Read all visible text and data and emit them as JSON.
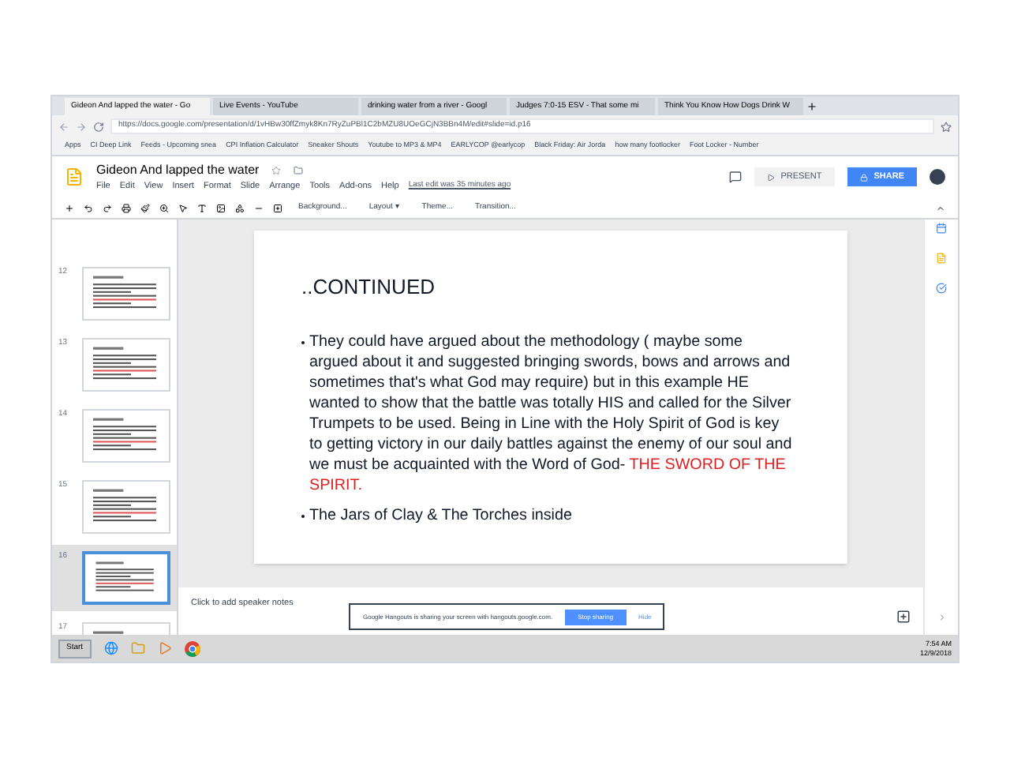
{
  "browser": {
    "tabs": [
      {
        "title": "Gideon And lapped the water - Go",
        "selected": true
      },
      {
        "title": "Live Events - YouTube",
        "selected": false
      },
      {
        "title": "drinking water from a river - Googl",
        "selected": false
      },
      {
        "title": "Judges 7:0-15 ESV - That some mi",
        "selected": false
      },
      {
        "title": "Think You Know How Dogs Drink W",
        "selected": false
      }
    ],
    "url": "https://docs.google.com/presentation/d/1vHBw30ffZmyk8Kn7RyZuPBl1C2bMZU8UOeGCjN3BBn4M/edit#slide=id.p16",
    "bookmarks": [
      "Apps",
      "CI Deep Link",
      "Feeds - Upcoming snea",
      "CPI Inflation Calculator",
      "Sneaker Shouts",
      "Youtube to MP3 & MP4",
      "EARLYCOP @earlycop",
      "Black Friday: Air Jorda",
      "how many footlocker",
      "Foot Locker - Number"
    ]
  },
  "docs": {
    "title": "Gideon And lapped the water",
    "menu": [
      "File",
      "Edit",
      "View",
      "Insert",
      "Format",
      "Slide",
      "Arrange",
      "Tools",
      "Add-ons",
      "Help"
    ],
    "last_edit": "Last edit was 35 minutes ago",
    "present": "PRESENT",
    "share": "SHARE",
    "toolbar": [
      "Background...",
      "Layout ▾",
      "Theme...",
      "Transition..."
    ]
  },
  "thumbnails": [
    {
      "number": "12",
      "selected": false
    },
    {
      "number": "13",
      "selected": false
    },
    {
      "number": "14",
      "selected": false
    },
    {
      "number": "15",
      "selected": false
    },
    {
      "number": "16",
      "selected": true
    },
    {
      "number": "17",
      "selected": false
    }
  ],
  "slide": {
    "title": "..CONTINUED",
    "bullets": [
      {
        "text": "They could have argued about the methodology ( maybe some argued about it and suggested bringing swords, bows and arrows and sometimes that's what God may require) but in this example HE wanted to show that the battle was totally HIS and called for the Silver Trumpets to be used. Being in Line with the Holy Spirit of God is key to getting victory in our daily battles against the enemy of our soul and we must be acquainted with the Word of God- ",
        "highlight": "THE SWORD OF THE SPIRIT."
      },
      {
        "text": "The Jars of Clay & The Torches inside"
      }
    ]
  },
  "notes_placeholder": "Click to add speaker notes",
  "hangouts": {
    "message": "Google Hangouts is sharing your screen with hangouts.google.com.",
    "stop": "Stop sharing",
    "hide": "Hide"
  },
  "taskbar": {
    "start": "Start",
    "time": "7:54 AM",
    "date": "12/9/2018"
  }
}
